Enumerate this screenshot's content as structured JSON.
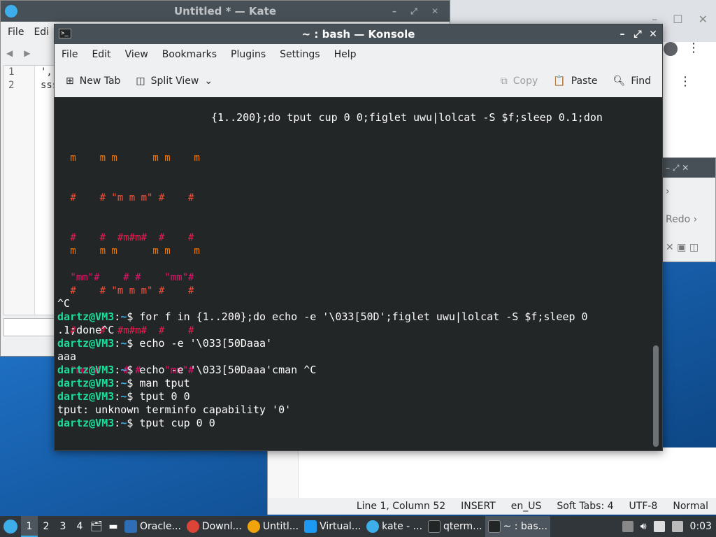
{
  "kate": {
    "title": "Untitled * — Kate",
    "menu": [
      "File",
      "Edi"
    ],
    "line_numbers": [
      "1",
      "2"
    ],
    "lines": [
      "',-.",
      "sss"
    ],
    "status": {
      "position": "Line 1, Column 52",
      "mode": "INSERT",
      "language": "en_US",
      "tabs": "Soft Tabs: 4",
      "encoding": "UTF-8",
      "input_mode": "Normal"
    }
  },
  "qwin": {
    "redo_label": "Redo"
  },
  "konsole": {
    "title": "~ : bash — Konsole",
    "menu": [
      "File",
      "Edit",
      "View",
      "Bookmarks",
      "Plugins",
      "Settings",
      "Help"
    ],
    "toolbar": {
      "new_tab": "New Tab",
      "split_view": "Split View",
      "copy": "Copy",
      "paste": "Paste",
      "find": "Find"
    },
    "terminal": {
      "top_line": "{1..200};do tput cup 0 0;figlet uwu|lolcat -S $f;sleep 0.1;don",
      "art1": [
        " m    m m      m m    m",
        " #    # \"m m m\" #    #",
        " #    #  #m#m#  #    #",
        " \"mm\"#    # #    \"mm\"#"
      ],
      "art2": [
        " m    m m      m m    m",
        " #    # \"m m m\" #    #",
        " #    #  #m#m#  #    #",
        " \"mm\"#    # #    \"mm\"#"
      ],
      "interrupt": "^C",
      "prompt_user": "dartz@VM3",
      "prompt_sep": ":",
      "prompt_path": "~",
      "prompt_sign": "$ ",
      "cmd1": "for f in {1..200};do echo -e '\\033[50D';figlet uwu|lolcat -S $f;sleep 0",
      "cmd1_wrap": ".1;done^C",
      "cmd2": "echo -e '\\033[50Daaa'",
      "out2": "aaa",
      "cmd3": "echo -e '\\033[50Daaa'cman ^C",
      "cmd4": "man tput",
      "cmd5": "tput 0 0",
      "out5": "tput: unknown terminfo capability '0'",
      "cmd6": "tput cup 0 0"
    }
  },
  "taskbar": {
    "desktops": [
      "1",
      "2",
      "3",
      "4"
    ],
    "tasks": [
      {
        "label": "Oracle...",
        "icon": "virtualbox-icon",
        "color": "#2f6db5"
      },
      {
        "label": "Downl...",
        "icon": "chrome-icon",
        "color": "#db4437"
      },
      {
        "label": "Untitl...",
        "icon": "kate-icon",
        "color": "#f0a30a"
      },
      {
        "label": "Virtual...",
        "icon": "virtualbox-vm-icon",
        "color": "#1d99f3"
      },
      {
        "label": "kate - ...",
        "icon": "kde-icon",
        "color": "#3daee9"
      },
      {
        "label": "qterm...",
        "icon": "terminal-icon",
        "color": "#232627"
      },
      {
        "label": "~ : bas...",
        "icon": "konsole-icon",
        "color": "#232627"
      }
    ],
    "clock": "0:03"
  }
}
